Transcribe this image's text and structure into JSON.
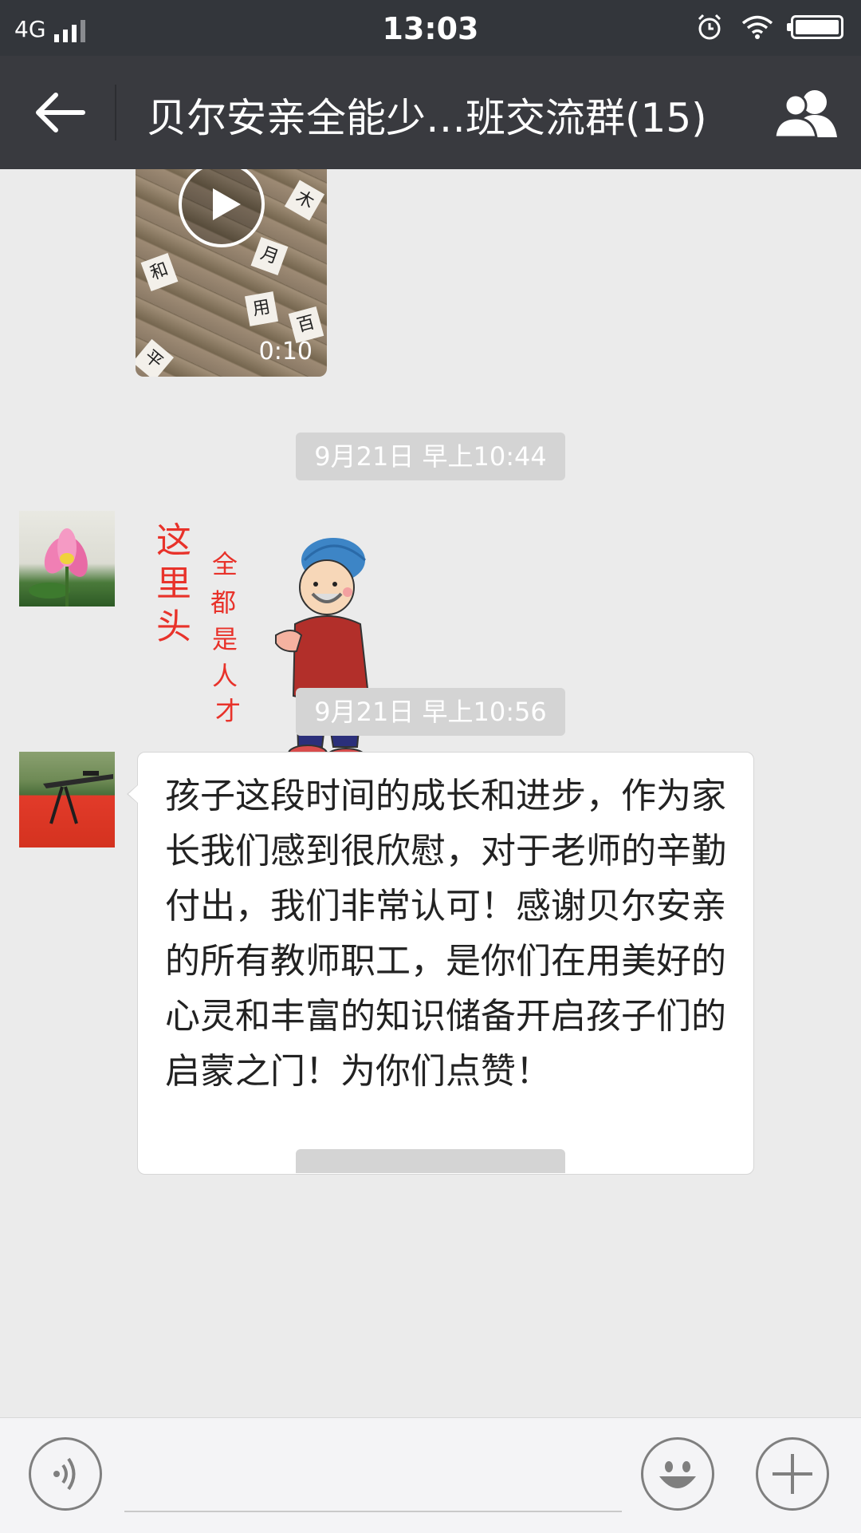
{
  "status_bar": {
    "network": "4G",
    "time": "13:03"
  },
  "title_bar": {
    "title": "贝尔安亲全能少…班交流群(15)",
    "back_icon": "arrow-left-icon",
    "group_icon": "group-members-icon"
  },
  "messages": {
    "video": {
      "duration": "0:10",
      "cards": [
        "和",
        "月",
        "用",
        "百",
        "木",
        "平"
      ]
    },
    "timestamp1": "9月21日 早上10:44",
    "sticker": {
      "text_left": "这里头",
      "text_right": "全都是人才"
    },
    "timestamp2": "9月21日 早上10:56",
    "text_message": "孩子这段时间的成长和进步，作为家长我们感到很欣慰，对于老师的辛勤付出，我们非常认可！感谢贝尔安亲的所有教师职工，是你们在用美好的心灵和丰富的知识储备开启孩子们的启蒙之门！为你们点赞！"
  },
  "input_bar": {
    "voice_icon": "voice-input-icon",
    "emoji_icon": "emoji-icon",
    "plus_icon": "plus-icon"
  },
  "colors": {
    "status_bar": "#33363b",
    "title_bar": "#393a3f",
    "chat_bg": "#ebebeb",
    "timestamp_bg": "#d4d4d4"
  }
}
